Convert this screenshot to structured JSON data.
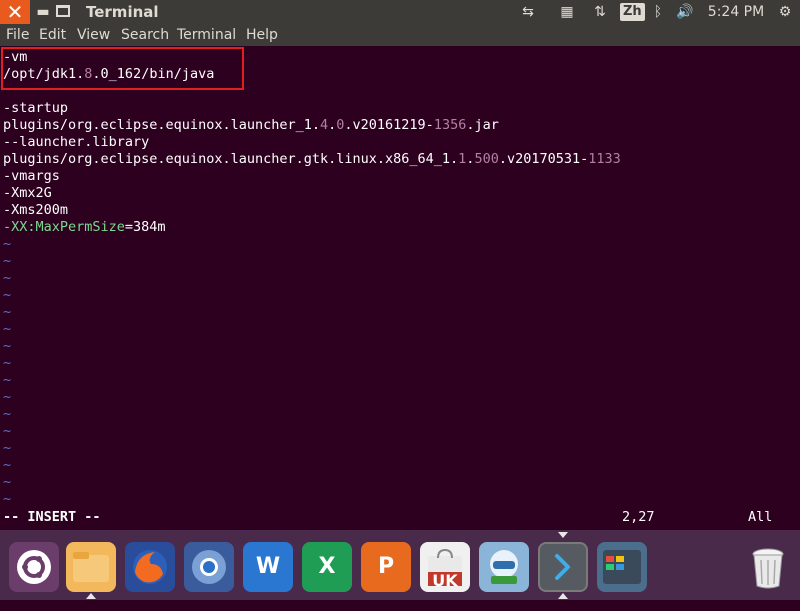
{
  "window": {
    "title": "Terminal"
  },
  "tray": {
    "input_method": "Zh",
    "clock": "5:24 PM"
  },
  "menu": [
    "File",
    "Edit",
    "View",
    "Search",
    "Terminal",
    "Help"
  ],
  "editor": {
    "lines": [
      {
        "parts": [
          {
            "t": "-vm",
            "c": ""
          }
        ]
      },
      {
        "parts": [
          {
            "t": "/opt/jdk1.",
            "c": ""
          },
          {
            "t": "8",
            "c": "hl"
          },
          {
            "t": ".0_162/bin/java",
            "c": ""
          }
        ]
      },
      {
        "parts": []
      },
      {
        "parts": [
          {
            "t": "-startup",
            "c": ""
          }
        ]
      },
      {
        "parts": [
          {
            "t": "plugins/org.eclipse.equinox.launcher_1.",
            "c": ""
          },
          {
            "t": "4",
            "c": "hl"
          },
          {
            "t": ".",
            "c": ""
          },
          {
            "t": "0",
            "c": "hl"
          },
          {
            "t": ".v20161219-",
            "c": ""
          },
          {
            "t": "1356",
            "c": "hl"
          },
          {
            "t": ".jar",
            "c": ""
          }
        ]
      },
      {
        "parts": [
          {
            "t": "--launcher.library",
            "c": ""
          }
        ]
      },
      {
        "parts": [
          {
            "t": "plugins/org.eclipse.equinox.launcher.gtk.linux.x86_64_1.",
            "c": ""
          },
          {
            "t": "1",
            "c": "hl"
          },
          {
            "t": ".",
            "c": ""
          },
          {
            "t": "500",
            "c": "hl"
          },
          {
            "t": ".v20170531-",
            "c": ""
          },
          {
            "t": "1133",
            "c": "hl"
          }
        ]
      },
      {
        "parts": [
          {
            "t": "-vmargs",
            "c": ""
          }
        ]
      },
      {
        "parts": [
          {
            "t": "-Xmx2G",
            "c": ""
          }
        ]
      },
      {
        "parts": [
          {
            "t": "-Xms200m",
            "c": ""
          }
        ]
      },
      {
        "parts": [
          {
            "t": "-XX:MaxPermSize",
            "c": "green"
          },
          {
            "t": "=384m",
            "c": ""
          }
        ]
      }
    ],
    "tilde": "~",
    "tilde_count": 16,
    "mode": "-- INSERT --",
    "position": "2,27",
    "scroll": "All"
  },
  "dock": {
    "apps": [
      "ubuntu-dash",
      "files",
      "firefox",
      "chromium",
      "wps-writer",
      "wps-spreadsheets",
      "wps-presentation",
      "ubuntu-software",
      "system-monitor",
      "terminal",
      "workspace-switcher",
      "trash"
    ],
    "labels": {
      "writer": "W",
      "spreadsheets": "X",
      "presentation": "P",
      "software": "UK"
    }
  },
  "colors": {
    "accent": "#e85a1d",
    "terminal_bg": "#2c001e",
    "highlight_box": "#e02020"
  }
}
